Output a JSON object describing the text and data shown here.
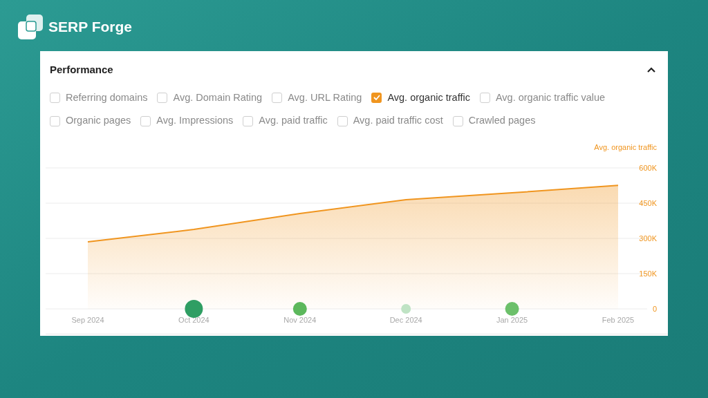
{
  "brand": {
    "name": "SERP Forge"
  },
  "panel": {
    "title": "Performance",
    "expanded": true,
    "metrics": [
      {
        "label": "Referring domains",
        "checked": false
      },
      {
        "label": "Avg. Domain Rating",
        "checked": false
      },
      {
        "label": "Avg. URL Rating",
        "checked": false
      },
      {
        "label": "Avg. organic traffic",
        "checked": true
      },
      {
        "label": "Avg. organic traffic value",
        "checked": false
      },
      {
        "label": "Organic pages",
        "checked": false
      },
      {
        "label": "Avg. Impressions",
        "checked": false
      },
      {
        "label": "Avg. paid traffic",
        "checked": false
      },
      {
        "label": "Avg. paid traffic cost",
        "checked": false
      },
      {
        "label": "Crawled pages",
        "checked": false
      }
    ],
    "events": [
      {
        "marker": false
      },
      {
        "marker": true,
        "kind": "large",
        "color": "#2f9e63"
      },
      {
        "marker": true,
        "kind": "medium",
        "color": "#5cb85c"
      },
      {
        "marker": true,
        "kind": "small",
        "color": "#bfe3c4"
      },
      {
        "marker": true,
        "kind": "medium",
        "color": "#6cc06a"
      },
      {
        "marker": false
      }
    ],
    "chart_data": {
      "type": "area",
      "grid": true,
      "categories": [
        "Sep 2024",
        "Oct 2024",
        "Nov 2024",
        "Dec 2024",
        "Jan 2025",
        "Feb 2025"
      ],
      "series": [
        {
          "name": "Avg. organic traffic",
          "color": "#f0951f",
          "values": [
            285000,
            338000,
            406000,
            465000,
            494000,
            526000
          ]
        }
      ],
      "ylim": [
        0,
        600000
      ],
      "yticks": [
        {
          "value": 0,
          "label": "0"
        },
        {
          "value": 150000,
          "label": "150K"
        },
        {
          "value": 300000,
          "label": "300K"
        },
        {
          "value": 450000,
          "label": "450K"
        },
        {
          "value": 600000,
          "label": "600K"
        }
      ]
    }
  }
}
